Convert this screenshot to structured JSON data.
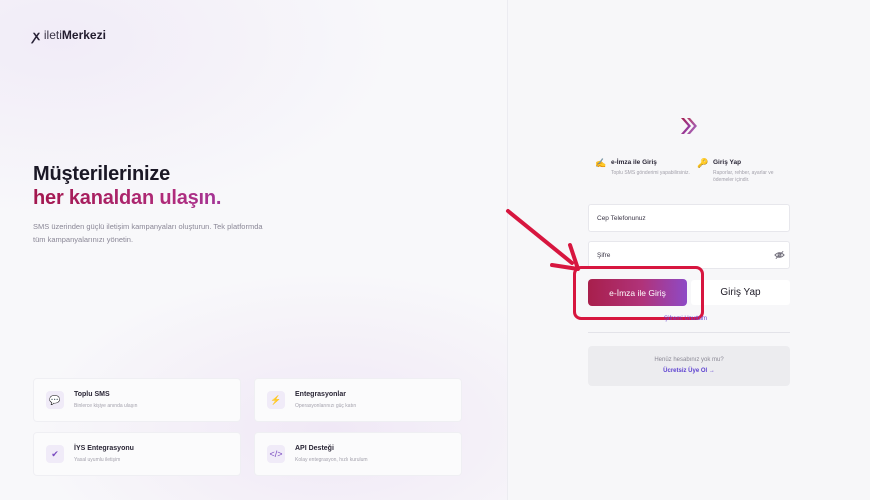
{
  "brand": {
    "mark": "ꭗ",
    "name_light": "ileti",
    "name_bold": "Merkezi"
  },
  "hero": {
    "line1": "Müşterilerinize",
    "line2": "her kanaldan ulaşın.",
    "description": "SMS üzerinden güçlü iletişim kampanyaları oluşturun. Tek platformda tüm kampanyalarınızı yönetin."
  },
  "features": [
    {
      "icon": "sms-bubble-icon",
      "glyph": "💬",
      "title": "Toplu SMS",
      "subtitle": "Binlerce kişiye anında ulaşın"
    },
    {
      "icon": "plug-icon",
      "glyph": "⚡",
      "title": "Entegrasyonlar",
      "subtitle": "Operasyonlarınızı güç katın"
    },
    {
      "icon": "check-circle-icon",
      "glyph": "✔",
      "title": "İYS Entegrasyonu",
      "subtitle": "Yasal uyumlu iletişim"
    },
    {
      "icon": "code-icon",
      "glyph": "</>",
      "title": "API Desteği",
      "subtitle": "Kolay entegrasyon, hızlı kurulum"
    }
  ],
  "login": {
    "options": [
      {
        "icon": "signature-icon",
        "glyph": "✍",
        "title": "e-İmza ile Giriş",
        "subtitle": "Toplu SMS gönderimi yapabilirsiniz."
      },
      {
        "icon": "key-icon",
        "glyph": "🔑",
        "title": "Giriş Yap",
        "subtitle": "Raporlar, rehber, ayarlar ve ödemeler içindir."
      }
    ],
    "phone_placeholder": "Cep Telefonunuz",
    "password_placeholder": "Şifre",
    "esign_button": "e-İmza ile Giriş",
    "login_button": "Giriş Yap",
    "forgot_password": "Şifremi Unuttum",
    "signup_question": "Henüz hesabınız yok mu?",
    "signup_link": "Ücretsiz Üye Ol →"
  },
  "colors": {
    "accent_start": "#a81f4c",
    "accent_end": "#8e4ac6",
    "highlight": "#d7163f",
    "link": "#5b3fd0"
  }
}
